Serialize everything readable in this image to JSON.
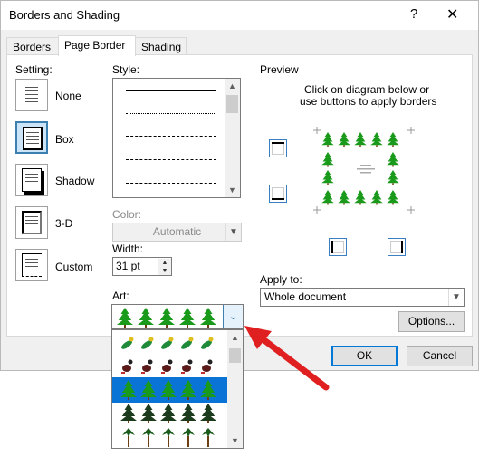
{
  "window": {
    "title": "Borders and Shading",
    "help_glyph": "?",
    "close_glyph": "✕"
  },
  "tabs": [
    {
      "label": "Borders"
    },
    {
      "label": "Page Border"
    },
    {
      "label": "Shading"
    }
  ],
  "setting": {
    "heading": "Setting:",
    "options": [
      {
        "label": "None"
      },
      {
        "label": "Box"
      },
      {
        "label": "Shadow"
      },
      {
        "label": "3-D"
      },
      {
        "label": "Custom"
      }
    ],
    "selected": "Box"
  },
  "style": {
    "heading": "Style:"
  },
  "color": {
    "label": "Color:",
    "value": "Automatic"
  },
  "width": {
    "label": "Width:",
    "value": "31 pt"
  },
  "art": {
    "label": "Art:",
    "selected": "trees"
  },
  "preview": {
    "heading": "Preview",
    "instruction_line1": "Click on diagram below or",
    "instruction_line2": "use buttons to apply borders"
  },
  "apply_to": {
    "label": "Apply to:",
    "value": "Whole document"
  },
  "buttons": {
    "options": "Options...",
    "ok": "OK",
    "cancel": "Cancel"
  },
  "colors": {
    "accent": "#0078d7",
    "tree_green": "#1a9a1a",
    "arrow_red": "#e02020",
    "selection": "#0a74d6"
  }
}
